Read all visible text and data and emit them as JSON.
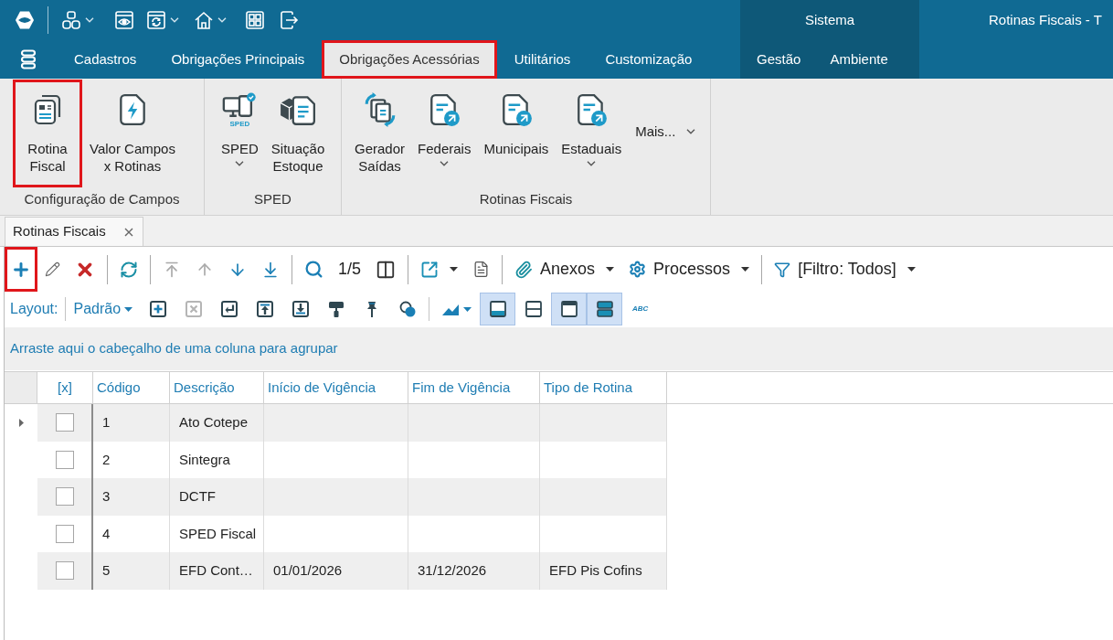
{
  "title_bar": {
    "section": "Sistema",
    "title": "Rotinas Fiscais - T"
  },
  "menu": {
    "tabs": [
      {
        "label": "Cadastros",
        "selected": false,
        "highlighted": false
      },
      {
        "label": "Obrigações Principais",
        "selected": false,
        "highlighted": false
      },
      {
        "label": "Obrigações Acessórias",
        "selected": true,
        "highlighted": true
      },
      {
        "label": "Utilitários",
        "selected": false,
        "highlighted": false
      },
      {
        "label": "Customização",
        "selected": false,
        "highlighted": false
      }
    ],
    "system_tabs": [
      {
        "label": "Gestão",
        "selected": false
      },
      {
        "label": "Ambiente",
        "selected": false
      }
    ]
  },
  "ribbon": {
    "groups": [
      {
        "label": "Configuração de Campos",
        "buttons": [
          {
            "kind": "large",
            "label": "Rotina\nFiscal",
            "dropdown": false,
            "highlighted": true
          },
          {
            "kind": "large",
            "label": "Valor Campos\nx Rotinas",
            "dropdown": false,
            "highlighted": false
          }
        ]
      },
      {
        "label": "SPED",
        "buttons": [
          {
            "kind": "large",
            "label": "SPED",
            "icon_caption": "SPED",
            "dropdown": true,
            "highlighted": false
          },
          {
            "kind": "large",
            "label": "Situação\nEstoque",
            "dropdown": false,
            "highlighted": false
          }
        ]
      },
      {
        "label": "Rotinas Fiscais",
        "buttons": [
          {
            "kind": "large",
            "label": "Gerador\nSaídas",
            "dropdown": false,
            "highlighted": false
          },
          {
            "kind": "large",
            "label": "Federais",
            "dropdown": true,
            "highlighted": false
          },
          {
            "kind": "large",
            "label": "Municipais",
            "dropdown": false,
            "highlighted": false
          },
          {
            "kind": "large",
            "label": "Estaduais",
            "dropdown": true,
            "highlighted": false
          },
          {
            "kind": "more",
            "label": "Mais...",
            "dropdown": true,
            "highlighted": false
          }
        ]
      }
    ]
  },
  "document_tabs": [
    {
      "label": "Rotinas Fiscais",
      "selected": true
    }
  ],
  "record_toolbar": {
    "groups": [
      {
        "items": [
          {
            "kind": "add",
            "highlighted": true,
            "disabled": false,
            "dropdown": false
          },
          {
            "kind": "edit",
            "highlighted": false,
            "disabled": false,
            "dropdown": false
          },
          {
            "kind": "delete",
            "highlighted": false,
            "disabled": false,
            "dropdown": false
          }
        ]
      },
      {
        "items": [
          {
            "kind": "refresh",
            "highlighted": false,
            "disabled": false,
            "dropdown": false
          }
        ]
      },
      {
        "items": [
          {
            "kind": "first",
            "highlighted": false,
            "disabled": true,
            "dropdown": false
          },
          {
            "kind": "previous",
            "highlighted": false,
            "disabled": true,
            "dropdown": false
          },
          {
            "kind": "next",
            "highlighted": false,
            "disabled": false,
            "dropdown": false
          },
          {
            "kind": "last",
            "highlighted": false,
            "disabled": false,
            "dropdown": false
          }
        ]
      },
      {
        "items": [
          {
            "kind": "search",
            "highlighted": false,
            "disabled": false,
            "dropdown": false
          },
          {
            "kind": "position",
            "label": "1/5",
            "highlighted": false,
            "disabled": false,
            "dropdown": false
          },
          {
            "kind": "columns",
            "highlighted": false,
            "disabled": false,
            "dropdown": false
          }
        ]
      },
      {
        "items": [
          {
            "kind": "export",
            "highlighted": false,
            "disabled": false,
            "dropdown": true
          },
          {
            "kind": "report",
            "highlighted": false,
            "disabled": false,
            "dropdown": false
          }
        ]
      },
      {
        "items": [
          {
            "kind": "attachments",
            "label": "Anexos",
            "highlighted": false,
            "disabled": false,
            "dropdown": true
          },
          {
            "kind": "processes",
            "label": "Processos",
            "highlighted": false,
            "disabled": false,
            "dropdown": true
          }
        ]
      },
      {
        "items": [
          {
            "kind": "filter",
            "label": "[Filtro: Todos]",
            "highlighted": false,
            "disabled": false,
            "dropdown": true
          }
        ]
      }
    ]
  },
  "layout_toolbar": {
    "label": "Layout:",
    "preset": {
      "label": "Padrão",
      "dropdown": true
    },
    "groups": [
      {
        "items": [
          {
            "kind": "add-row",
            "disabled": false,
            "pressed": false,
            "dropdown": false
          },
          {
            "kind": "delete-row",
            "disabled": true,
            "pressed": false,
            "dropdown": false
          },
          {
            "kind": "enter",
            "disabled": false,
            "pressed": false,
            "dropdown": false
          },
          {
            "kind": "upload",
            "disabled": false,
            "pressed": false,
            "dropdown": false
          },
          {
            "kind": "download",
            "disabled": false,
            "pressed": false,
            "dropdown": false
          },
          {
            "kind": "paint",
            "disabled": false,
            "pressed": false,
            "dropdown": false
          },
          {
            "kind": "pin",
            "disabled": false,
            "pressed": false,
            "dropdown": false
          },
          {
            "kind": "shapes",
            "disabled": false,
            "pressed": false,
            "dropdown": false
          }
        ]
      },
      {
        "items": [
          {
            "kind": "chart",
            "disabled": false,
            "pressed": false,
            "dropdown": true
          },
          {
            "kind": "pane-bottom",
            "disabled": false,
            "pressed": true,
            "dropdown": false
          },
          {
            "kind": "pane-split",
            "disabled": false,
            "pressed": false,
            "dropdown": false
          },
          {
            "kind": "pane-top",
            "disabled": false,
            "pressed": true,
            "dropdown": false
          },
          {
            "kind": "pane-rows",
            "disabled": false,
            "pressed": true,
            "dropdown": false
          },
          {
            "kind": "spell",
            "caption": "ABC",
            "disabled": false,
            "pressed": false,
            "dropdown": false
          }
        ]
      }
    ]
  },
  "group_panel": {
    "hint": "Arraste aqui o cabeçalho de uma coluna para agrupar"
  },
  "grid": {
    "columns": [
      {
        "label": "[x]"
      },
      {
        "label": "Código"
      },
      {
        "label": "Descrição"
      },
      {
        "label": "Início de Vigência"
      },
      {
        "label": "Fim de Vigência"
      },
      {
        "label": "Tipo de Rotina"
      }
    ],
    "rows": [
      {
        "current": true,
        "checked": false,
        "code": "1",
        "description": "Ato Cotepe"
      },
      {
        "current": false,
        "checked": false,
        "code": "2",
        "description": "Sintegra"
      },
      {
        "current": false,
        "checked": false,
        "code": "3",
        "description": "DCTF"
      },
      {
        "current": false,
        "checked": false,
        "code": "4",
        "description": "SPED Fiscal"
      },
      {
        "current": false,
        "checked": false,
        "code": "5",
        "description": "EFD Cont…",
        "start": "01/01/2026",
        "end": "31/12/2026",
        "type": "EFD Pis Cofins"
      }
    ]
  }
}
